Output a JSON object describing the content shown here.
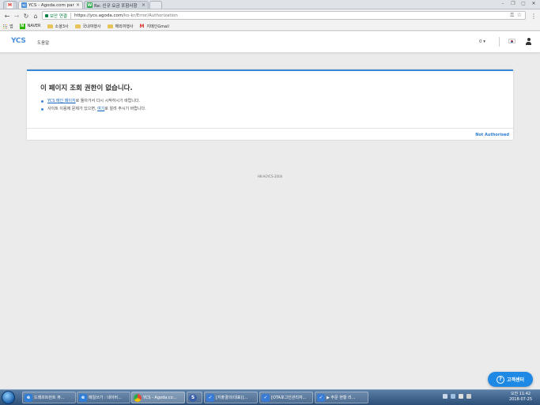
{
  "browser": {
    "tabs": [
      {
        "title": "",
        "favicon": "M",
        "active": false
      },
      {
        "title": "YCS - Agoda.com partne",
        "favicon": "YC",
        "active": true
      },
      {
        "title": "Re: 신규 요금 포함사항 ",
        "favicon": "W",
        "active": false
      }
    ],
    "secure_label": "보안 연결",
    "url_host": "https://ycs.agoda.com",
    "url_path": "/ko-kr/Error/Authorization",
    "bookmarks": [
      {
        "label": "앱",
        "icon": "apps-icon"
      },
      {
        "label": "NAVER",
        "icon": "naver-icon"
      },
      {
        "label": "소셜3사",
        "icon": "folder-icon"
      },
      {
        "label": "국내여행사",
        "icon": "folder-icon"
      },
      {
        "label": "해외여행사",
        "icon": "folder-icon"
      },
      {
        "label": "지메인Gmail",
        "icon": "gmail-icon"
      }
    ]
  },
  "site": {
    "logo": "YCS",
    "help_link": "도움말",
    "counter": "0"
  },
  "error": {
    "title": "이 페이지 조회 권한이 없습니다.",
    "line1_link": "YCS 메인 페이지",
    "line1_rest": "로 돌아가서 다시 시작하시기 바랍니다.",
    "line2_pre": "사이트 이용에 문제가 있으면, ",
    "line2_link": "여기",
    "line2_rest": "로 알려 주시기 바랍니다.",
    "status": "Not Authorised",
    "code": "HK-AGYCS-2004"
  },
  "help_button": "고객센터",
  "taskbar": {
    "items": [
      {
        "label": "드래프트런트 뷰...",
        "icon": "ie-icon",
        "color": "#2f7fd8"
      },
      {
        "label": "메일쓰기 : 네이버...",
        "icon": "ie-icon",
        "color": "#2f7fd8"
      },
      {
        "label": "YCS - Agoda.co...",
        "icon": "chrome-icon",
        "color": "#e04a3a"
      },
      {
        "label": "",
        "icon": "app-icon",
        "color": "#3a5fa8"
      },
      {
        "label": "[지출결의(대표)]...",
        "icon": "doc-icon",
        "color": "#3a7bd5"
      },
      {
        "label": "[OTA포그인관리자...",
        "icon": "doc-icon",
        "color": "#3a7bd5"
      },
      {
        "label": "▶ 주문 현황 리...",
        "icon": "doc-icon",
        "color": "#3a7bd5"
      }
    ],
    "time": "오전 11:42",
    "date": "2018-07-25"
  }
}
